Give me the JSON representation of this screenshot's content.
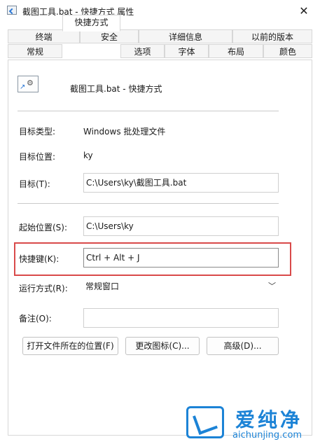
{
  "window": {
    "title": "截图工具.bat - 快捷方式 属性",
    "close_glyph": "✕"
  },
  "tabs_back": [
    "终端",
    "安全",
    "详细信息",
    "以前的版本"
  ],
  "tabs_front": [
    "常规",
    "快捷方式",
    "选项",
    "字体",
    "布局",
    "颜色"
  ],
  "active_tab": "快捷方式",
  "header": {
    "name": "截图工具.bat - 快捷方式"
  },
  "fields": {
    "target_type": {
      "label": "目标类型:",
      "value": "Windows 批处理文件"
    },
    "target_location": {
      "label": "目标位置:",
      "value": "ky"
    },
    "target": {
      "label": "目标(T):",
      "value": "C:\\Users\\ky\\截图工具.bat"
    },
    "start_in": {
      "label": "起始位置(S):",
      "value": "C:\\Users\\ky"
    },
    "shortcut_key": {
      "label": "快捷键(K):",
      "value": "Ctrl + Alt + J"
    },
    "run": {
      "label": "运行方式(R):",
      "value": "常规窗口"
    },
    "comment": {
      "label": "备注(O):",
      "value": ""
    }
  },
  "buttons": {
    "open_location": "打开文件所在的位置(F)",
    "change_icon": "更改图标(C)...",
    "advanced": "高级(D)..."
  },
  "watermark": {
    "brand": "爱纯净",
    "url": "aichunjing.com"
  },
  "colors": {
    "highlight": "#d94a4a",
    "watermark": "#1c83d6"
  }
}
